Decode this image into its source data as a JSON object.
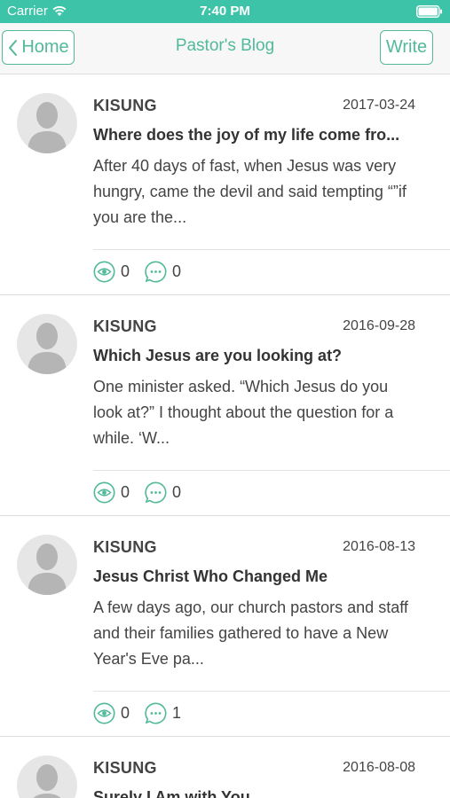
{
  "status": {
    "carrier": "Carrier",
    "time": "7:40 PM"
  },
  "nav": {
    "back_label": "Home",
    "title": "Pastor's Blog",
    "write_label": "Write"
  },
  "posts": [
    {
      "author": "KISUNG",
      "date": "2017-03-24",
      "title": "Where does the joy of my life come fro...",
      "excerpt": "After 40 days of fast, when Jesus was very hungry, came the devil and said tempting “”if you are the...",
      "views": "0",
      "comments": "0"
    },
    {
      "author": "KISUNG",
      "date": "2016-09-28",
      "title": "Which Jesus are you looking at?",
      "excerpt": "One minister asked. “Which Jesus do you look at?” I thought about the question for a while. ‘W...",
      "views": "0",
      "comments": "0"
    },
    {
      "author": "KISUNG",
      "date": "2016-08-13",
      "title": "Jesus Christ Who Changed Me",
      "excerpt": "A few days ago, our church pastors and staff and their families gathered to have a New Year's Eve pa...",
      "views": "0",
      "comments": "1"
    },
    {
      "author": "KISUNG",
      "date": "2016-08-08",
      "title": "Surely I Am with You"
    }
  ],
  "colors": {
    "status_bar": "#3cc3a8",
    "accent": "#52b99a"
  },
  "icons": [
    "wifi-icon",
    "battery-icon",
    "chevron-left-icon",
    "avatar-placeholder-icon",
    "eye-icon",
    "comment-icon"
  ]
}
